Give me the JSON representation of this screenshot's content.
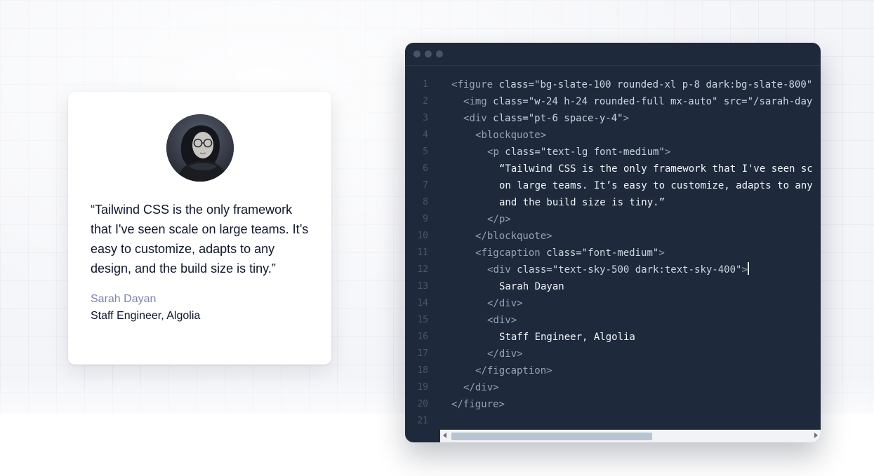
{
  "card": {
    "quote": "“Tailwind CSS is the only framework that I've seen scale on large teams. It’s easy to customize, adapts to any design, and the build size is tiny.”",
    "name": "Sarah Dayan",
    "role": "Staff Engineer, Algolia",
    "avatar_icon": "portrait-photo",
    "name_color": "#7c86a8"
  },
  "editor": {
    "window_dots": [
      "dot",
      "dot",
      "dot"
    ],
    "code_lines": [
      {
        "n": "1",
        "indent": 0,
        "parts": [
          [
            "punc",
            "<"
          ],
          [
            "tag",
            "figure "
          ],
          [
            "attr",
            "class="
          ],
          [
            "str",
            "\"bg-slate-100 rounded-xl p-8 dark:bg-slate-800\""
          ]
        ]
      },
      {
        "n": "2",
        "indent": 1,
        "parts": [
          [
            "punc",
            "<"
          ],
          [
            "tag",
            "img "
          ],
          [
            "attr",
            "class="
          ],
          [
            "str",
            "\"w-24 h-24 rounded-full mx-auto\" "
          ],
          [
            "attr",
            "src="
          ],
          [
            "str",
            "\"/sarah-day"
          ]
        ]
      },
      {
        "n": "3",
        "indent": 1,
        "parts": [
          [
            "punc",
            "<"
          ],
          [
            "tag",
            "div "
          ],
          [
            "attr",
            "class="
          ],
          [
            "str",
            "\"pt-6 space-y-4\""
          ],
          [
            "punc",
            ">"
          ]
        ]
      },
      {
        "n": "4",
        "indent": 2,
        "parts": [
          [
            "punc",
            "<"
          ],
          [
            "tag",
            "blockquote"
          ],
          [
            "punc",
            ">"
          ]
        ]
      },
      {
        "n": "5",
        "indent": 3,
        "parts": [
          [
            "punc",
            "<"
          ],
          [
            "tag",
            "p "
          ],
          [
            "attr",
            "class="
          ],
          [
            "str",
            "\"text-lg font-medium\""
          ],
          [
            "punc",
            ">"
          ]
        ]
      },
      {
        "n": "6",
        "indent": 4,
        "parts": [
          [
            "txt",
            "“Tailwind CSS is the only framework that I've seen sc"
          ]
        ]
      },
      {
        "n": "7",
        "indent": 4,
        "parts": [
          [
            "txt",
            "on large teams. It’s easy to customize, adapts to any"
          ]
        ]
      },
      {
        "n": "8",
        "indent": 4,
        "parts": [
          [
            "txt",
            "and the build size is tiny.”"
          ]
        ]
      },
      {
        "n": "9",
        "indent": 3,
        "parts": [
          [
            "punc",
            "</"
          ],
          [
            "tag",
            "p"
          ],
          [
            "punc",
            ">"
          ]
        ]
      },
      {
        "n": "10",
        "indent": 2,
        "parts": [
          [
            "punc",
            "</"
          ],
          [
            "tag",
            "blockquote"
          ],
          [
            "punc",
            ">"
          ]
        ]
      },
      {
        "n": "11",
        "indent": 2,
        "parts": [
          [
            "punc",
            "<"
          ],
          [
            "tag",
            "figcaption "
          ],
          [
            "attr",
            "class="
          ],
          [
            "str",
            "\"font-medium\""
          ],
          [
            "punc",
            ">"
          ]
        ]
      },
      {
        "n": "12",
        "indent": 3,
        "parts": [
          [
            "punc",
            "<"
          ],
          [
            "tag",
            "div "
          ],
          [
            "attr",
            "class="
          ],
          [
            "str",
            "\"text-sky-500 dark:text-sky-400\""
          ],
          [
            "punc",
            ">"
          ],
          [
            "caret",
            ""
          ]
        ]
      },
      {
        "n": "13",
        "indent": 4,
        "parts": [
          [
            "txt",
            "Sarah Dayan"
          ]
        ]
      },
      {
        "n": "14",
        "indent": 3,
        "parts": [
          [
            "punc",
            "</"
          ],
          [
            "tag",
            "div"
          ],
          [
            "punc",
            ">"
          ]
        ]
      },
      {
        "n": "15",
        "indent": 3,
        "parts": [
          [
            "punc",
            "<"
          ],
          [
            "tag",
            "div"
          ],
          [
            "punc",
            ">"
          ]
        ]
      },
      {
        "n": "16",
        "indent": 4,
        "parts": [
          [
            "txt",
            "Staff Engineer, Algolia"
          ]
        ]
      },
      {
        "n": "17",
        "indent": 3,
        "parts": [
          [
            "punc",
            "</"
          ],
          [
            "tag",
            "div"
          ],
          [
            "punc",
            ">"
          ]
        ]
      },
      {
        "n": "18",
        "indent": 2,
        "parts": [
          [
            "punc",
            "</"
          ],
          [
            "tag",
            "figcaption"
          ],
          [
            "punc",
            ">"
          ]
        ]
      },
      {
        "n": "19",
        "indent": 1,
        "parts": [
          [
            "punc",
            "</"
          ],
          [
            "tag",
            "div"
          ],
          [
            "punc",
            ">"
          ]
        ]
      },
      {
        "n": "20",
        "indent": 0,
        "parts": [
          [
            "punc",
            "</"
          ],
          [
            "tag",
            "figure"
          ],
          [
            "punc",
            ">"
          ]
        ]
      },
      {
        "n": "21",
        "indent": 0,
        "parts": []
      }
    ],
    "scrollbar": {
      "position_fraction": 0.0,
      "visible_fraction": 0.56
    }
  },
  "colors": {
    "editor_bg": "#1e293b",
    "accent_name": "#7c86a8",
    "text_dark": "#0f172a"
  }
}
